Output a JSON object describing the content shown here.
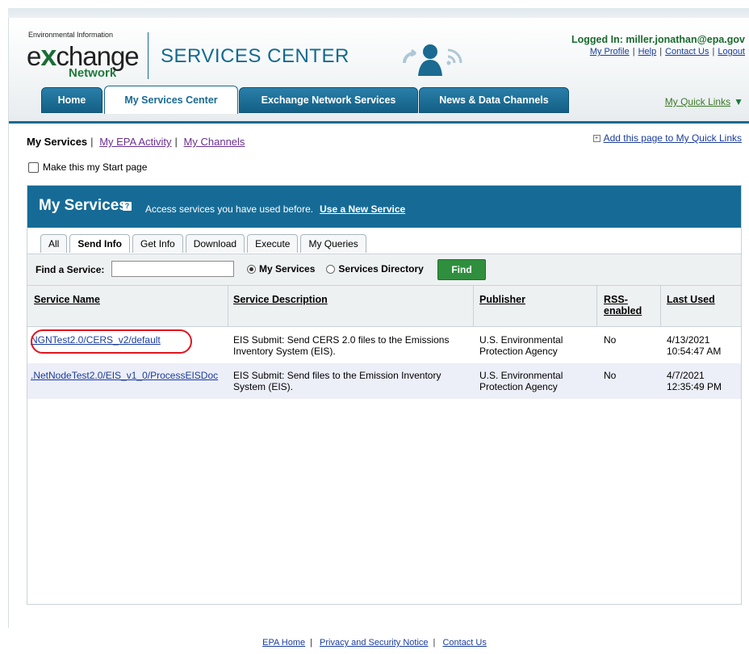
{
  "header": {
    "logo_small": "Environmental Information",
    "logo_pre": "e",
    "logo_x": "x",
    "logo_post": "change",
    "logo_network": "Network",
    "services_center": "SERVICES CENTER",
    "logged_in": "Logged In: miller.jonathan@epa.gov",
    "links": [
      "My Profile",
      "Help",
      "Contact Us",
      "Logout"
    ]
  },
  "tabs": [
    {
      "label": "Home",
      "active": false
    },
    {
      "label": "My Services Center",
      "active": true
    },
    {
      "label": "Exchange Network Services",
      "active": false
    },
    {
      "label": "News & Data Channels",
      "active": false
    }
  ],
  "quick_links": "My Quick Links",
  "subnav": {
    "current": "My Services",
    "items": [
      "My EPA Activity",
      "My Channels"
    ]
  },
  "add_quick_link": "Add this page to My Quick Links",
  "start_page": "Make this my Start page",
  "panel": {
    "title": "My Services",
    "desc": "Access services you have used before.",
    "new_service": "Use a New Service",
    "subtabs": [
      {
        "label": "All",
        "active": false
      },
      {
        "label": "Send Info",
        "active": true
      },
      {
        "label": "Get Info",
        "active": false
      },
      {
        "label": "Download",
        "active": false
      },
      {
        "label": "Execute",
        "active": false
      },
      {
        "label": "My Queries",
        "active": false
      }
    ],
    "find_label": "Find a Service:",
    "find_value": "",
    "radio_my": "My Services",
    "radio_dir": "Services Directory",
    "find_button": "Find",
    "columns": [
      "Service Name",
      "Service Description",
      "Publisher",
      "RSS-\nenabled",
      "Last Used"
    ],
    "rows": [
      {
        "name": "NGNTest2.0/CERS_v2/default",
        "desc1": "EIS Submit: Send CERS 2.0 files to the Emissions",
        "desc2": "Inventory System (EIS).",
        "pub1": "U.S. Environmental",
        "pub2": "Protection Agency",
        "rss": "No",
        "date1": "4/13/2021",
        "date2": "10:54:47 AM"
      },
      {
        "name": ".NetNodeTest2.0/EIS_v1_0/ProcessEISDoc",
        "desc1": "EIS Submit: Send files to the Emission Inventory",
        "desc2": "System (EIS).",
        "pub1": "U.S. Environmental",
        "pub2": "Protection Agency",
        "rss": "No",
        "date1": "4/7/2021",
        "date2": "12:35:49 PM"
      }
    ]
  },
  "footer": [
    "EPA Home",
    "Privacy and Security Notice",
    "Contact Us"
  ],
  "colors": {
    "brand_blue": "#166b96",
    "green": "#2f8f3e",
    "highlight_red": "#e0141e"
  },
  "icons": {
    "help": "question-mark-icon",
    "people": "people-signal-icon",
    "add": "plus-box-icon",
    "dropdown": "triangle-down-icon"
  }
}
